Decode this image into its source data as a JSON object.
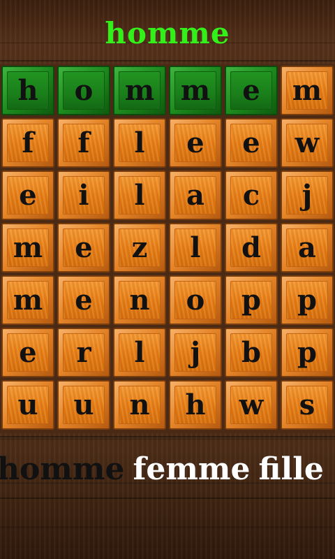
{
  "title": "homme",
  "colors": {
    "title": "#33f01a",
    "tile_orange": "#e77f18",
    "tile_green": "#1a7f1a",
    "found_word": "#111111",
    "pending_word": "#ffffff"
  },
  "grid": {
    "rows": [
      [
        {
          "l": "h",
          "s": "green"
        },
        {
          "l": "o",
          "s": "green"
        },
        {
          "l": "m",
          "s": "green"
        },
        {
          "l": "m",
          "s": "green"
        },
        {
          "l": "e",
          "s": "green"
        },
        {
          "l": "m",
          "s": "orange"
        }
      ],
      [
        {
          "l": "f",
          "s": "orange"
        },
        {
          "l": "f",
          "s": "orange"
        },
        {
          "l": "l",
          "s": "orange"
        },
        {
          "l": "e",
          "s": "orange"
        },
        {
          "l": "e",
          "s": "orange"
        },
        {
          "l": "w",
          "s": "orange"
        }
      ],
      [
        {
          "l": "e",
          "s": "orange"
        },
        {
          "l": "i",
          "s": "orange"
        },
        {
          "l": "l",
          "s": "orange"
        },
        {
          "l": "a",
          "s": "orange"
        },
        {
          "l": "c",
          "s": "orange"
        },
        {
          "l": "j",
          "s": "orange"
        }
      ],
      [
        {
          "l": "m",
          "s": "orange"
        },
        {
          "l": "e",
          "s": "orange"
        },
        {
          "l": "z",
          "s": "orange"
        },
        {
          "l": "l",
          "s": "orange"
        },
        {
          "l": "d",
          "s": "orange"
        },
        {
          "l": "a",
          "s": "orange"
        }
      ],
      [
        {
          "l": "m",
          "s": "orange"
        },
        {
          "l": "e",
          "s": "orange"
        },
        {
          "l": "n",
          "s": "orange"
        },
        {
          "l": "o",
          "s": "orange"
        },
        {
          "l": "p",
          "s": "orange"
        },
        {
          "l": "p",
          "s": "orange"
        }
      ],
      [
        {
          "l": "e",
          "s": "orange"
        },
        {
          "l": "r",
          "s": "orange"
        },
        {
          "l": "l",
          "s": "orange"
        },
        {
          "l": "j",
          "s": "orange"
        },
        {
          "l": "b",
          "s": "orange"
        },
        {
          "l": "p",
          "s": "orange"
        }
      ],
      [
        {
          "l": "u",
          "s": "orange"
        },
        {
          "l": "u",
          "s": "orange"
        },
        {
          "l": "n",
          "s": "orange"
        },
        {
          "l": "h",
          "s": "orange"
        },
        {
          "l": "w",
          "s": "orange"
        },
        {
          "l": "s",
          "s": "orange"
        }
      ]
    ]
  },
  "word_list": [
    {
      "text": "homme",
      "status": "found"
    },
    {
      "text": "femme",
      "status": "pending"
    },
    {
      "text": "fille",
      "status": "pending"
    }
  ]
}
